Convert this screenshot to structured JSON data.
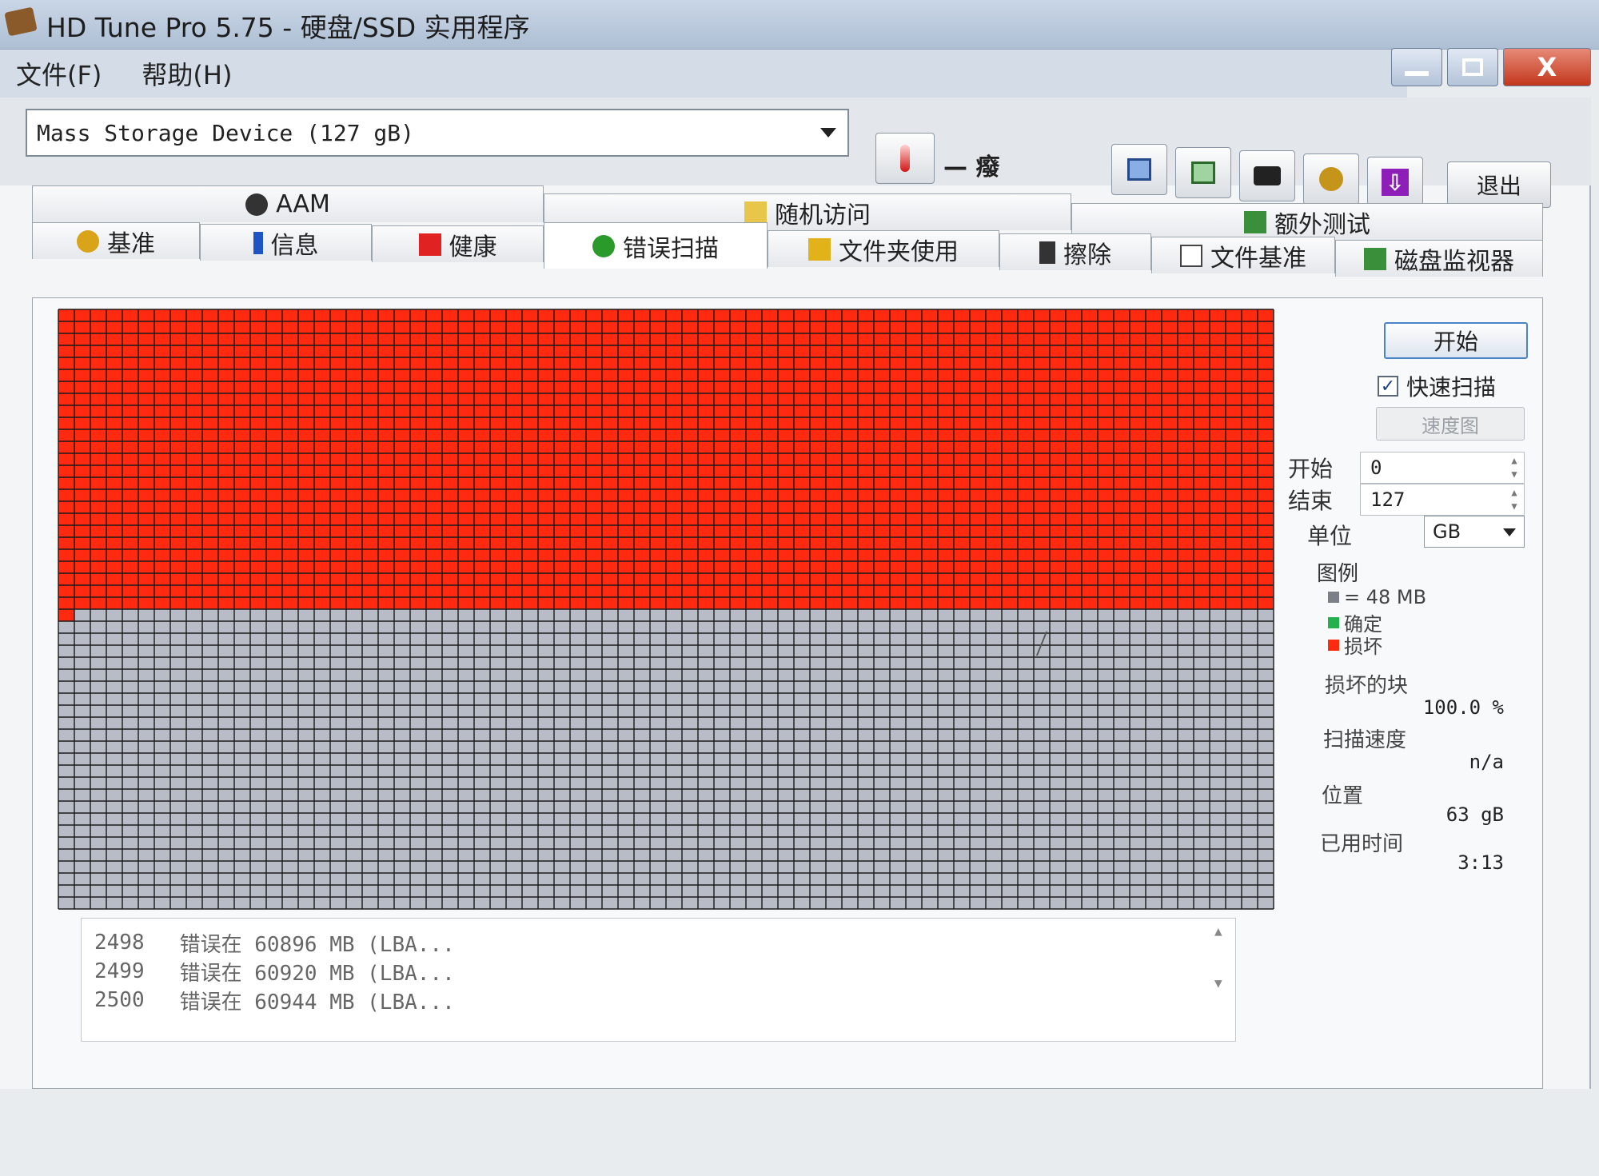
{
  "window": {
    "title": "HD Tune Pro 5.75 - 硬盘/SSD 实用程序",
    "close_glyph": "X"
  },
  "menu": [
    "文件(F)",
    "帮助(H)"
  ],
  "toolbar": {
    "device": "Mass Storage Device (127 gB)",
    "temperature": "— 癈",
    "exit_label": "退出",
    "download_glyph": "⇩"
  },
  "tabs": {
    "row1": [
      "AAM",
      "随机访问",
      "额外测试"
    ],
    "row2": [
      "基准",
      "信息",
      "健康",
      "错误扫描",
      "文件夹使用",
      "擦除",
      "文件基准",
      "磁盘监视器"
    ],
    "active": "错误扫描"
  },
  "scan": {
    "start_button": "开始",
    "quick_scan_label": "快速扫描",
    "quick_scan_checked": true,
    "check_glyph": "✓",
    "speed_map_button": "速度图",
    "start_label": "开始",
    "start_value": "0",
    "end_label": "结束",
    "end_value": "127",
    "unit_label": "单位",
    "unit_value": "GB",
    "legend_label": "图例",
    "legend_block": "= 48 MB",
    "legend_ok": "确定",
    "legend_bad": "损坏",
    "bad_blocks_label": "损坏的块",
    "bad_blocks_value": "100.0 %",
    "scan_speed_label": "扫描速度",
    "scan_speed_value": "n/a",
    "position_label": "位置",
    "position_value": "63 gB",
    "elapsed_label": "已用时间",
    "elapsed_value": "3:13",
    "colors": {
      "bad": "#ff2a10",
      "unscanned": "#b7bcc6",
      "ok": "#22b14c",
      "grid": "#1b1b1b",
      "legend_block": "#7a7f88"
    },
    "grid_fraction_scanned": 0.5
  },
  "log": [
    {
      "index": "2498",
      "text": "错误在 60896 MB (LBA..."
    },
    {
      "index": "2499",
      "text": "错误在 60920 MB (LBA..."
    },
    {
      "index": "2500",
      "text": "错误在 60944 MB (LBA..."
    }
  ]
}
